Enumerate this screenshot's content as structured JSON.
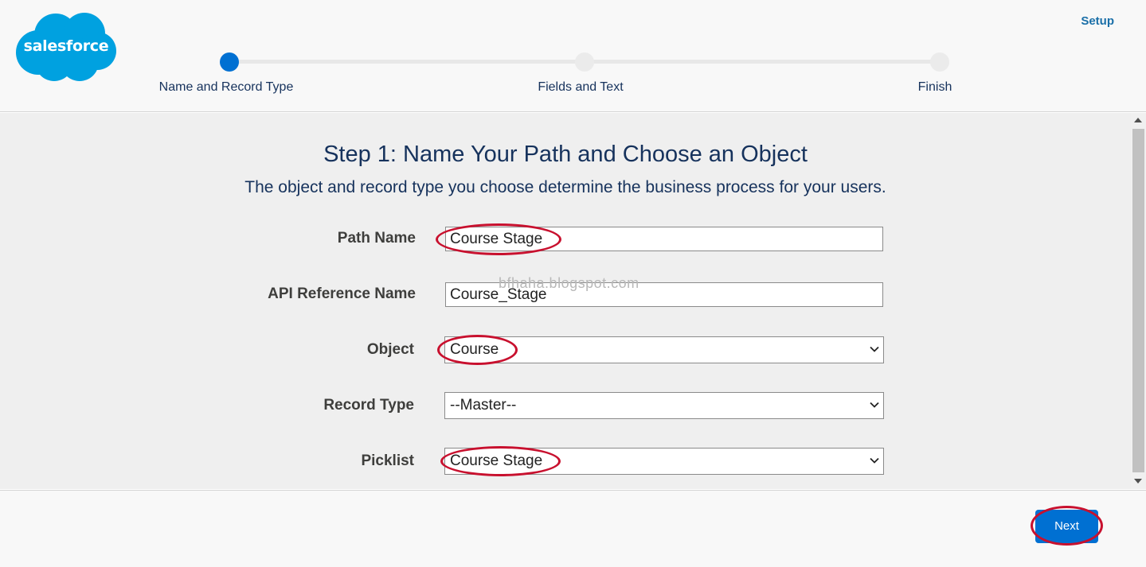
{
  "header": {
    "logo_text": "salesforce",
    "setup_label": "Setup"
  },
  "progress": {
    "steps": [
      {
        "label": "Name and Record Type",
        "state": "active"
      },
      {
        "label": "Fields and Text",
        "state": "inactive"
      },
      {
        "label": "Finish",
        "state": "inactive"
      }
    ]
  },
  "main": {
    "title": "Step 1: Name Your Path and Choose an Object",
    "subtitle": "The object and record type you choose determine the business process for your users.",
    "watermark": "bfhaha.blogspot.com",
    "fields": {
      "path_name": {
        "label": "Path Name",
        "value": "Course Stage"
      },
      "api_name": {
        "label": "API Reference Name",
        "value": "Course_Stage"
      },
      "object": {
        "label": "Object",
        "value": "Course"
      },
      "record_type": {
        "label": "Record Type",
        "value": "--Master--"
      },
      "picklist": {
        "label": "Picklist",
        "value": "Course Stage"
      }
    }
  },
  "footer": {
    "next_label": "Next"
  },
  "colors": {
    "brand": "#00a1e0",
    "accent": "#0070d2",
    "annotation": "#c8102e"
  }
}
